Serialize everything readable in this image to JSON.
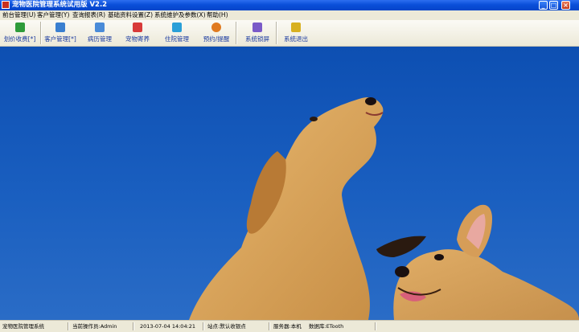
{
  "window": {
    "title": "宠物医院管理系统试用版 V2.2",
    "minimize": "_",
    "maximize": "□",
    "close": "×"
  },
  "menu": [
    {
      "label": "前台管理(U)"
    },
    {
      "label": "客户管理(Y)"
    },
    {
      "label": "查询报表(R)"
    },
    {
      "label": "基础资料设置(Z)"
    },
    {
      "label": "系统维护及参数(X)"
    },
    {
      "label": "帮助(H)"
    }
  ],
  "toolbar": [
    {
      "label": "划价收费[*]",
      "icon": "money-icon",
      "color": "#2e9b3a"
    },
    {
      "label": "客户管理[*]",
      "icon": "customer-icon",
      "color": "#3a7fd0"
    },
    {
      "label": "病历管理",
      "icon": "medical-record-icon",
      "color": "#4a8bd8"
    },
    {
      "label": "宠物寄养",
      "icon": "pet-boarding-icon",
      "color": "#d83a3a"
    },
    {
      "label": "住院管理",
      "icon": "hospitalization-icon",
      "color": "#2a9fd8"
    },
    {
      "label": "预约/提醒",
      "icon": "alarm-clock-icon",
      "color": "#e07a20"
    },
    {
      "label": "系统锁屏",
      "icon": "lock-screen-icon",
      "color": "#7a5ac8"
    },
    {
      "label": "系统退出",
      "icon": "exit-icon",
      "color": "#d8b020"
    }
  ],
  "status": {
    "app_name": "宠物医院管理系统",
    "operator": "当前操作员:Admin",
    "datetime": "2013-07-04 14:04:21",
    "station": "站点:默认收银点",
    "server": "服务器:本机",
    "database": "数据库:ETooth"
  },
  "background": {
    "sky_color": "#1456b8",
    "dog_color": "#d9a55f"
  }
}
